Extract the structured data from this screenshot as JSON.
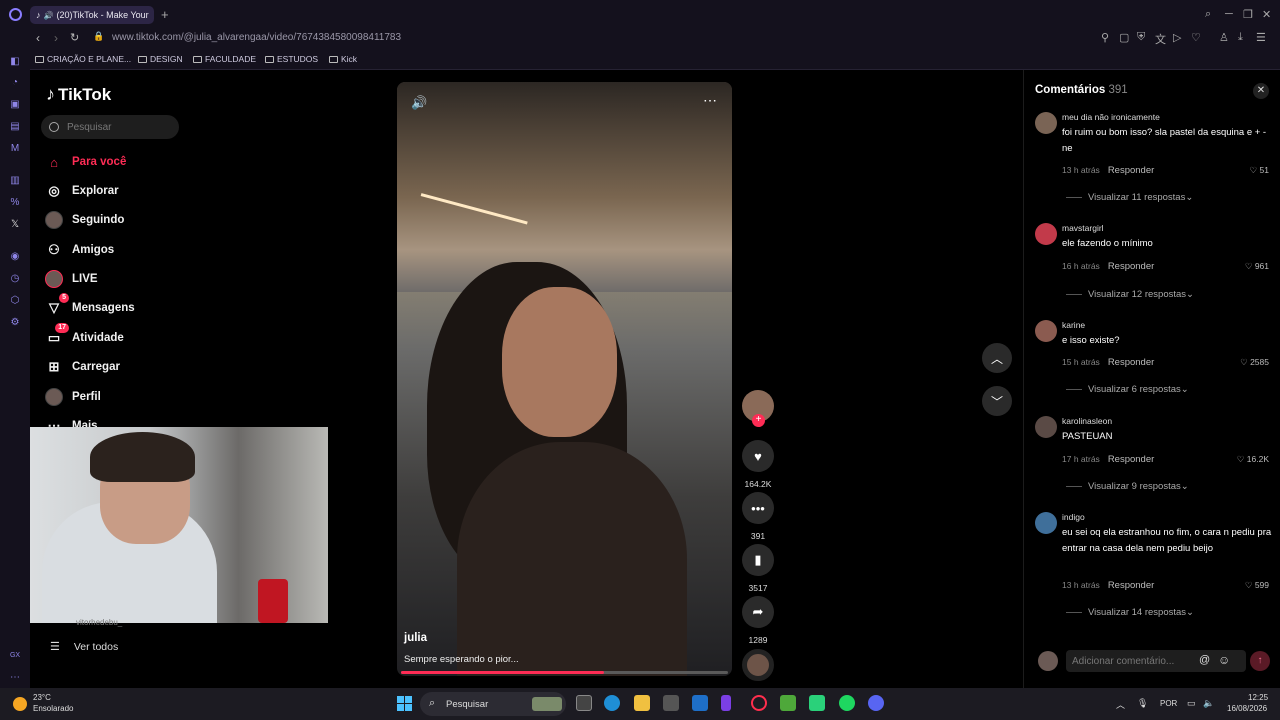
{
  "browser": {
    "tab_title": "(20)TikTok - Make Your",
    "url": "www.tiktok.com/@julia_alvarengaa/video/7674384580098411783",
    "bookmarks": [
      "CRIAÇÃO E PLANE...",
      "DESIGN",
      "FACULDADE",
      "ESTUDOS",
      "Kick"
    ]
  },
  "tiktok": {
    "logo": "TikTok",
    "search_placeholder": "Pesquisar",
    "nav": [
      {
        "label": "Para você",
        "icon": "home-icon",
        "active": true
      },
      {
        "label": "Explorar",
        "icon": "compass-icon"
      },
      {
        "label": "Seguindo",
        "icon": "following-avatar-icon"
      },
      {
        "label": "Amigos",
        "icon": "friends-icon"
      },
      {
        "label": "LIVE",
        "icon": "live-icon"
      },
      {
        "label": "Mensagens",
        "icon": "messages-icon",
        "badge": "5"
      },
      {
        "label": "Atividade",
        "icon": "activity-icon",
        "badge": "17"
      },
      {
        "label": "Carregar",
        "icon": "upload-icon"
      },
      {
        "label": "Perfil",
        "icon": "profile-icon"
      },
      {
        "label": "Mais",
        "icon": "more-icon"
      }
    ],
    "ver_todos": "Ver todos",
    "following_partial": "vitorhedebu_"
  },
  "video": {
    "username": "julia",
    "caption": "Sempre esperando o pior...",
    "progress": 0.62,
    "actions": {
      "likes": "164.2K",
      "comments": "391",
      "saves": "3517",
      "shares": "1289"
    }
  },
  "comments": {
    "title": "Comentários",
    "count": "391",
    "reply_label": "Responder",
    "input_placeholder": "Adicionar comentário...",
    "items": [
      {
        "user": "meu dia não ironicamente",
        "text": "foi ruim ou bom isso? sla pastel da esquina e + - ne",
        "time": "13 h atrás",
        "likes": "51",
        "replies": "Visualizar 11 respostas"
      },
      {
        "user": "mavstargirl",
        "text": "ele fazendo o mínimo",
        "time": "16 h atrás",
        "likes": "961",
        "replies": "Visualizar 12 respostas"
      },
      {
        "user": "karine",
        "text": "e isso existe?",
        "time": "15 h atrás",
        "likes": "2585",
        "replies": "Visualizar 6 respostas"
      },
      {
        "user": "karolinasleon",
        "text": "PASTEUAN",
        "time": "17 h atrás",
        "likes": "16.2K",
        "replies": "Visualizar 9 respostas"
      },
      {
        "user": "indigo",
        "text": "eu sei oq ela estranhou no fim, o cara n pediu pra entrar na casa dela nem pediu beijo",
        "time": "13 h atrás",
        "likes": "599",
        "replies": "Visualizar 14 respostas"
      }
    ]
  },
  "taskbar": {
    "temp": "23°C",
    "weather": "Ensolarado",
    "search": "Pesquisar",
    "lang": "POR",
    "time": "12:25",
    "date": "16/08/2026"
  },
  "colors": {
    "accent": "#fe2c55",
    "background": "#000000",
    "browser_chrome": "#14111d"
  }
}
